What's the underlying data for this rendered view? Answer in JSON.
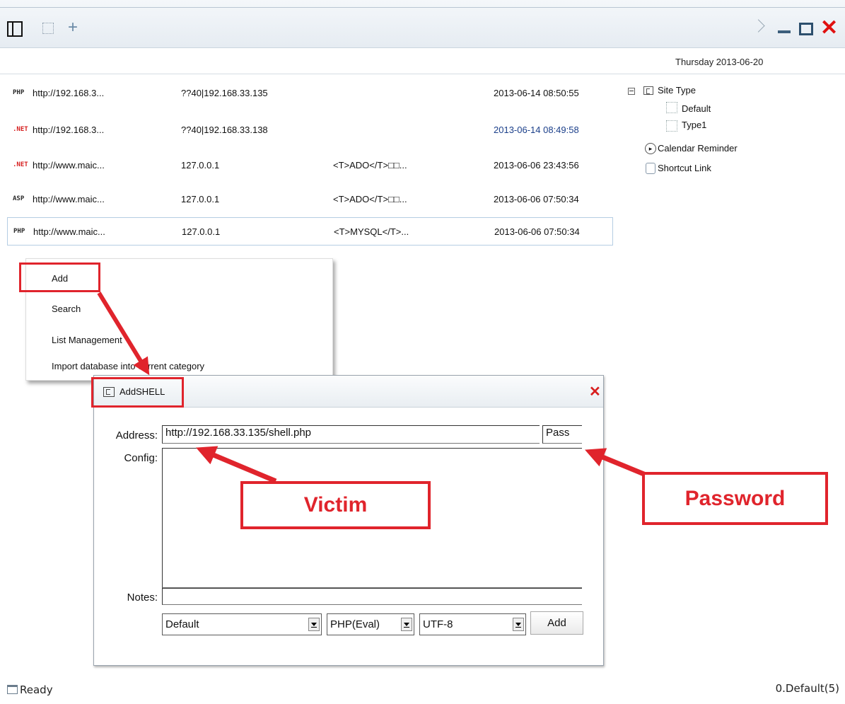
{
  "window": {
    "new_tab": "+",
    "close": "✕"
  },
  "header": {
    "date": "Thursday 2013-06-20"
  },
  "shells": [
    {
      "type": "PHP",
      "url": "http://192.168.3...",
      "ip": "??40|192.168.33.135",
      "remark": "",
      "time": "2013-06-14 08:50:55"
    },
    {
      "type": ".NET",
      "url": "http://192.168.3...",
      "ip": "??40|192.168.33.138",
      "remark": "",
      "time": "2013-06-14 08:49:58"
    },
    {
      "type": ".NET",
      "url": "http://www.maic...",
      "ip": "127.0.0.1",
      "remark": "<T>ADO</T>□□...",
      "time": "2013-06-06 23:43:56"
    },
    {
      "type": "ASP",
      "url": "http://www.maic...",
      "ip": "127.0.0.1",
      "remark": "<T>ADO</T>□□...",
      "time": "2013-06-06 07:50:34"
    },
    {
      "type": "PHP",
      "url": "http://www.maic...",
      "ip": "127.0.0.1",
      "remark": "<T>MYSQL</T>...",
      "time": "2013-06-06 07:50:34"
    }
  ],
  "tree": {
    "site_type": "Site Type",
    "default": "Default",
    "type1": "Type1",
    "calendar": "Calendar Reminder",
    "shortcut": "Shortcut Link"
  },
  "context_menu": {
    "add": "Add",
    "search": "Search",
    "list": "List Management",
    "import": "Import database into current category"
  },
  "dialog": {
    "title": "AddSHELL",
    "close": "✕",
    "address_label": "Address:",
    "address_value": "http://192.168.33.135/shell.php",
    "pass_value": "Pass",
    "config_label": "Config:",
    "notes_label": "Notes:",
    "category": "Default",
    "script_type": "PHP(Eval)",
    "encoding": "UTF-8",
    "add_button": "Add"
  },
  "callouts": {
    "victim": "Victim",
    "password": "Password"
  },
  "status": {
    "left": "Ready",
    "right": "0.Default(5)"
  },
  "colors": {
    "annotation_red": "#e0242c",
    "close_red": "#e01010"
  }
}
